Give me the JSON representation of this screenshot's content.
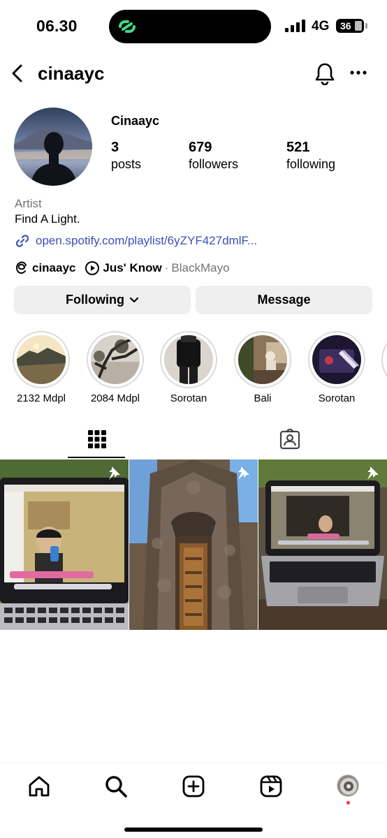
{
  "status_bar": {
    "time": "06.30",
    "network": "4G",
    "battery": "36"
  },
  "header": {
    "username": "cinaayc"
  },
  "profile": {
    "display_name": "Cinaayc",
    "stats": [
      {
        "value": "3",
        "label": "posts"
      },
      {
        "value": "679",
        "label": "followers"
      },
      {
        "value": "521",
        "label": "following"
      }
    ],
    "category": "Artist",
    "bio": "Find A Light.",
    "link": "open.spotify.com/playlist/6yZYF427dmlF...",
    "threads_name": "cinaayc",
    "song": "Jus' Know",
    "dot": "·",
    "artist": "BlackMayo"
  },
  "buttons": {
    "following": "Following",
    "message": "Message"
  },
  "highlights": [
    {
      "label": "2132 Mdpl"
    },
    {
      "label": "2084 Mdpl"
    },
    {
      "label": "Sorotan"
    },
    {
      "label": "Bali"
    },
    {
      "label": "Sorotan"
    }
  ],
  "icons": [
    "back-icon",
    "bell-icon",
    "more-icon",
    "link-icon",
    "threads-icon",
    "music-play-icon",
    "chevron-down-icon",
    "grid-icon",
    "tagged-icon",
    "pin-icon",
    "home-icon",
    "search-icon",
    "create-icon",
    "reels-icon"
  ],
  "colors": {
    "link": "#3a4fb8",
    "button_bg": "#efefef",
    "secondary_text": "#737373",
    "notification_dot": "#ff3040"
  }
}
